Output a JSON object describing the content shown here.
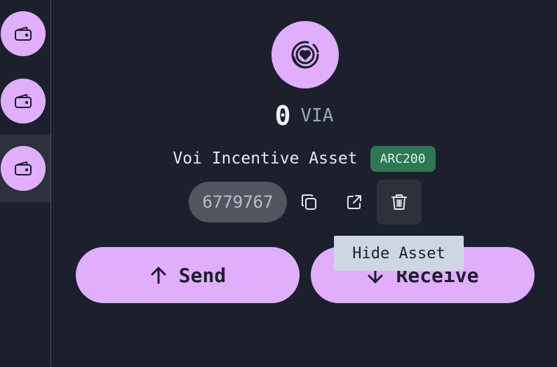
{
  "sidebar": {
    "items": [
      {
        "icon": "wallet-icon"
      },
      {
        "icon": "wallet-icon"
      },
      {
        "icon": "wallet-icon",
        "active": true
      }
    ]
  },
  "asset": {
    "icon": "voi-incentive-icon",
    "balance": "0",
    "unit": "VIA",
    "name": "Voi Incentive Asset",
    "standard": "ARC200",
    "id": "6779767"
  },
  "actions": {
    "send_label": "Send",
    "receive_label": "Receive"
  },
  "tooltip": {
    "text": "Hide Asset"
  },
  "colors": {
    "background": "#1b202c",
    "accent": "#e0aefb",
    "badge": "#2f7653",
    "chip": "#505560",
    "tooltip": "#cdd7e2"
  }
}
